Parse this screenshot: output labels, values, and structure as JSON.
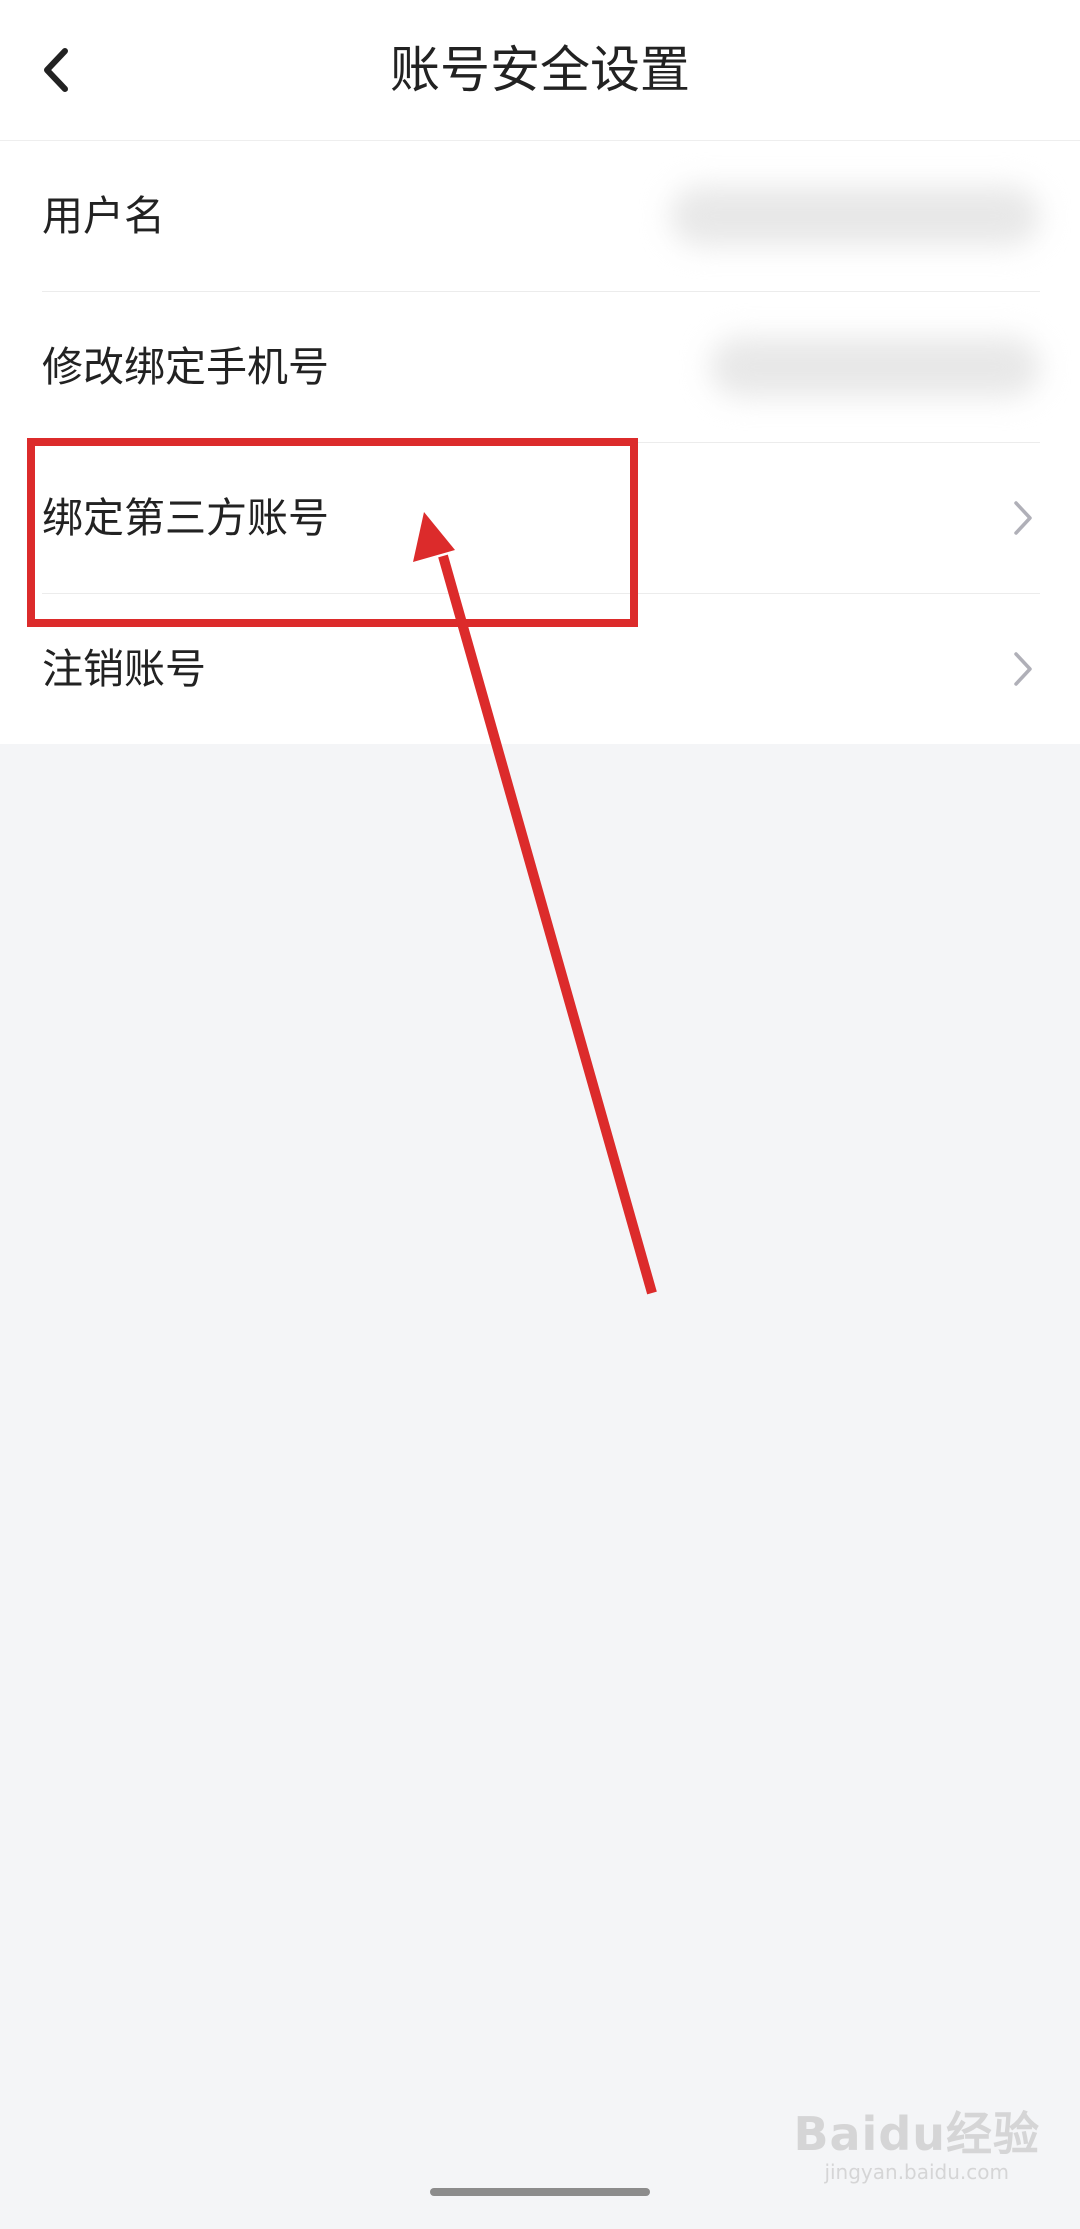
{
  "header": {
    "title": "账号安全设置",
    "back_icon": "chevron-left-icon"
  },
  "settings": {
    "items": [
      {
        "label": "用户名",
        "value_blurred": true,
        "has_chevron": false
      },
      {
        "label": "修改绑定手机号",
        "value_blurred": true,
        "has_chevron": false
      },
      {
        "label": "绑定第三方账号",
        "value_blurred": false,
        "has_chevron": true
      },
      {
        "label": "注销账号",
        "value_blurred": false,
        "has_chevron": true
      }
    ]
  },
  "annotation": {
    "color": "#dc2b2b",
    "highlight_target": "绑定第三方账号"
  },
  "watermark": {
    "logo": "Baidu经验",
    "url": "jingyan.baidu.com"
  },
  "colors": {
    "background": "#f4f5f7",
    "surface": "#ffffff",
    "chevron": "#b0b0b8"
  }
}
